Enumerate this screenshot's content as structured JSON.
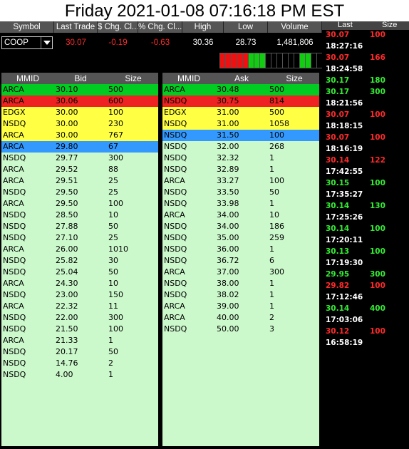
{
  "header": {
    "title": "Friday 2021-01-08 07:16:18 PM EST"
  },
  "summary": {
    "columns": [
      "Symbol",
      "Last Trade",
      "$ Chg. Cl...",
      "% Chg. Cl...",
      "High",
      "Low",
      "Volume"
    ],
    "symbol": "COOP",
    "last_trade": "30.07",
    "dollar_change": "-0.19",
    "percent_change": "-0.63",
    "high": "30.36",
    "low": "28.73",
    "volume": "1,481,806"
  },
  "tick_indicator": {
    "colors": [
      "red",
      "red",
      "red",
      "red",
      "red",
      "green",
      "green",
      "green",
      "black",
      "black",
      "black",
      "black",
      "black",
      "black",
      "green",
      "green",
      "black",
      "black"
    ]
  },
  "bid_book": {
    "columns": [
      "MMID",
      "Bid",
      "Size"
    ],
    "rows": [
      {
        "mmid": "ARCA",
        "price": "30.10",
        "size": "500",
        "level": "green"
      },
      {
        "mmid": "ARCA",
        "price": "30.06",
        "size": "600",
        "level": "red"
      },
      {
        "mmid": "EDGX",
        "price": "30.00",
        "size": "100",
        "level": "yellow"
      },
      {
        "mmid": "NSDQ",
        "price": "30.00",
        "size": "230",
        "level": "yellow"
      },
      {
        "mmid": "ARCA",
        "price": "30.00",
        "size": "767",
        "level": "yellow"
      },
      {
        "mmid": "ARCA",
        "price": "29.80",
        "size": "67",
        "level": "blue"
      },
      {
        "mmid": "NSDQ",
        "price": "29.77",
        "size": "300",
        "level": "light"
      },
      {
        "mmid": "ARCA",
        "price": "29.52",
        "size": "88",
        "level": "light"
      },
      {
        "mmid": "ARCA",
        "price": "29.51",
        "size": "25",
        "level": "light"
      },
      {
        "mmid": "NSDQ",
        "price": "29.50",
        "size": "25",
        "level": "light"
      },
      {
        "mmid": "ARCA",
        "price": "29.50",
        "size": "100",
        "level": "light"
      },
      {
        "mmid": "NSDQ",
        "price": "28.50",
        "size": "10",
        "level": "light"
      },
      {
        "mmid": "NSDQ",
        "price": "27.88",
        "size": "50",
        "level": "light"
      },
      {
        "mmid": "NSDQ",
        "price": "27.10",
        "size": "25",
        "level": "light"
      },
      {
        "mmid": "ARCA",
        "price": "26.00",
        "size": "1010",
        "level": "light"
      },
      {
        "mmid": "NSDQ",
        "price": "25.82",
        "size": "30",
        "level": "light"
      },
      {
        "mmid": "NSDQ",
        "price": "25.04",
        "size": "50",
        "level": "light"
      },
      {
        "mmid": "ARCA",
        "price": "24.30",
        "size": "10",
        "level": "light"
      },
      {
        "mmid": "NSDQ",
        "price": "23.00",
        "size": "150",
        "level": "light"
      },
      {
        "mmid": "ARCA",
        "price": "22.32",
        "size": "11",
        "level": "light"
      },
      {
        "mmid": "NSDQ",
        "price": "22.00",
        "size": "300",
        "level": "light"
      },
      {
        "mmid": "NSDQ",
        "price": "21.50",
        "size": "100",
        "level": "light"
      },
      {
        "mmid": "ARCA",
        "price": "21.33",
        "size": "1",
        "level": "light"
      },
      {
        "mmid": "NSDQ",
        "price": "20.17",
        "size": "50",
        "level": "light"
      },
      {
        "mmid": "NSDQ",
        "price": "14.76",
        "size": "2",
        "level": "light"
      },
      {
        "mmid": "NSDQ",
        "price": "4.00",
        "size": "1",
        "level": "light"
      }
    ]
  },
  "ask_book": {
    "columns": [
      "MMID",
      "Ask",
      "Size"
    ],
    "rows": [
      {
        "mmid": "ARCA",
        "price": "30.48",
        "size": "500",
        "level": "green"
      },
      {
        "mmid": "NSDQ",
        "price": "30.75",
        "size": "814",
        "level": "red"
      },
      {
        "mmid": "EDGX",
        "price": "31.00",
        "size": "500",
        "level": "yellow"
      },
      {
        "mmid": "NSDQ",
        "price": "31.00",
        "size": "1058",
        "level": "yellow"
      },
      {
        "mmid": "NSDQ",
        "price": "31.50",
        "size": "100",
        "level": "blue"
      },
      {
        "mmid": "NSDQ",
        "price": "32.00",
        "size": "268",
        "level": "light"
      },
      {
        "mmid": "NSDQ",
        "price": "32.32",
        "size": "1",
        "level": "light"
      },
      {
        "mmid": "NSDQ",
        "price": "32.89",
        "size": "1",
        "level": "light"
      },
      {
        "mmid": "ARCA",
        "price": "33.27",
        "size": "100",
        "level": "light"
      },
      {
        "mmid": "NSDQ",
        "price": "33.50",
        "size": "50",
        "level": "light"
      },
      {
        "mmid": "NSDQ",
        "price": "33.98",
        "size": "1",
        "level": "light"
      },
      {
        "mmid": "ARCA",
        "price": "34.00",
        "size": "10",
        "level": "light"
      },
      {
        "mmid": "NSDQ",
        "price": "34.00",
        "size": "186",
        "level": "light"
      },
      {
        "mmid": "NSDQ",
        "price": "35.00",
        "size": "259",
        "level": "light"
      },
      {
        "mmid": "NSDQ",
        "price": "36.00",
        "size": "1",
        "level": "light"
      },
      {
        "mmid": "NSDQ",
        "price": "36.72",
        "size": "6",
        "level": "light"
      },
      {
        "mmid": "ARCA",
        "price": "37.00",
        "size": "300",
        "level": "light"
      },
      {
        "mmid": "NSDQ",
        "price": "38.00",
        "size": "1",
        "level": "light"
      },
      {
        "mmid": "NSDQ",
        "price": "38.02",
        "size": "1",
        "level": "light"
      },
      {
        "mmid": "ARCA",
        "price": "39.00",
        "size": "1",
        "level": "light"
      },
      {
        "mmid": "ARCA",
        "price": "40.00",
        "size": "2",
        "level": "light"
      },
      {
        "mmid": "NSDQ",
        "price": "50.00",
        "size": "3",
        "level": "light"
      }
    ]
  },
  "level_colors": {
    "green": "#00cc22",
    "red": "#ee2222",
    "yellow": "#ffff44",
    "blue": "#3399ff",
    "light": "#ccf9cc"
  },
  "time_and_sales": {
    "columns": [
      "Last",
      "Size"
    ],
    "entries": [
      {
        "price": "30.07",
        "size": "100",
        "color": "red",
        "time": "18:27:16"
      },
      {
        "price": "30.07",
        "size": "166",
        "color": "red",
        "time": "18:24:58"
      },
      {
        "price": "30.17",
        "size": "180",
        "color": "green",
        "time": ""
      },
      {
        "price": "30.17",
        "size": "300",
        "color": "green",
        "time": "18:21:56"
      },
      {
        "price": "30.07",
        "size": "100",
        "color": "red",
        "time": "18:18:15"
      },
      {
        "price": "30.07",
        "size": "100",
        "color": "red",
        "time": "18:16:19"
      },
      {
        "price": "30.14",
        "size": "122",
        "color": "red",
        "time": "17:42:55"
      },
      {
        "price": "30.15",
        "size": "100",
        "color": "green",
        "time": "17:35:27"
      },
      {
        "price": "30.14",
        "size": "130",
        "color": "green",
        "time": "17:25:26"
      },
      {
        "price": "30.14",
        "size": "100",
        "color": "green",
        "time": "17:20:11"
      },
      {
        "price": "30.13",
        "size": "100",
        "color": "green",
        "time": "17:19:30"
      },
      {
        "price": "29.95",
        "size": "300",
        "color": "green",
        "time": ""
      },
      {
        "price": "29.82",
        "size": "100",
        "color": "red",
        "time": "17:12:46"
      },
      {
        "price": "30.14",
        "size": "400",
        "color": "green",
        "time": "17:03:06"
      },
      {
        "price": "30.12",
        "size": "100",
        "color": "red",
        "time": "16:58:19"
      }
    ]
  }
}
